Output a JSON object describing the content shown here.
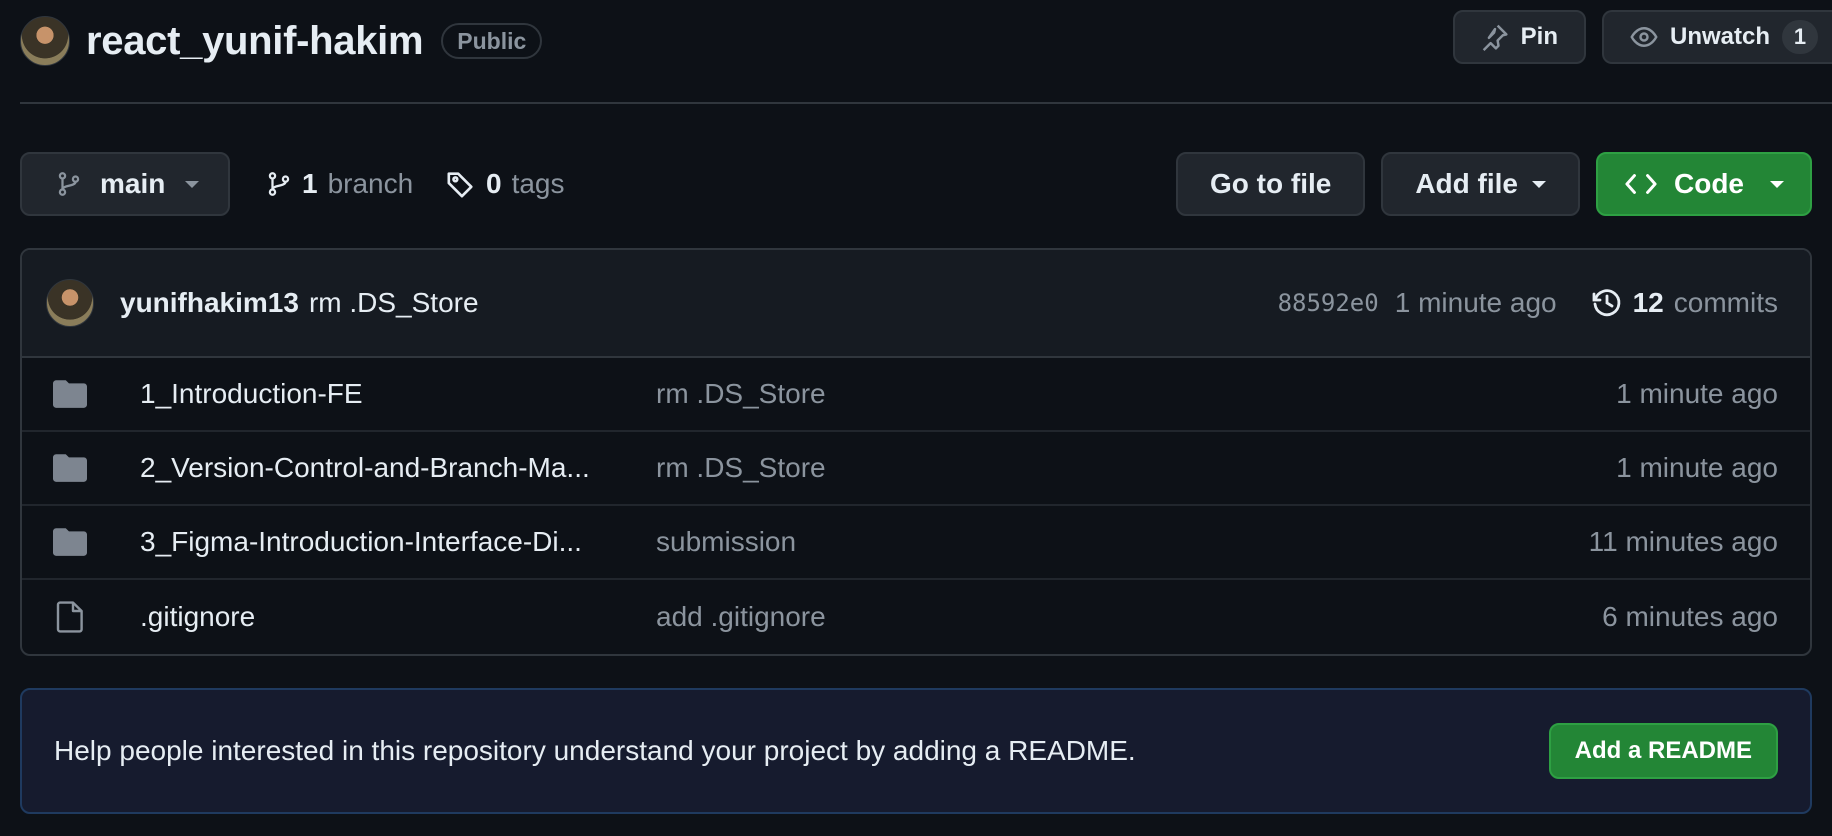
{
  "repo": {
    "name": "react_yunif-hakim",
    "visibility": "Public"
  },
  "header_actions": {
    "pin_label": "Pin",
    "unwatch_label": "Unwatch",
    "watch_count": "1"
  },
  "toolbar": {
    "branch_name": "main",
    "branch_count": "1",
    "branch_label": "branch",
    "tag_count": "0",
    "tag_label": "tags",
    "go_to_file_label": "Go to file",
    "add_file_label": "Add file",
    "code_label": "Code"
  },
  "latest_commit": {
    "author": "yunifhakim13",
    "message": "rm .DS_Store",
    "sha": "88592e0",
    "time": "1 minute ago",
    "commit_count": "12",
    "commits_label": "commits"
  },
  "files": [
    {
      "type": "folder",
      "name": "1_Introduction-FE",
      "commit": "rm .DS_Store",
      "age": "1 minute ago"
    },
    {
      "type": "folder",
      "name": "2_Version-Control-and-Branch-Ma...",
      "commit": "rm .DS_Store",
      "age": "1 minute ago"
    },
    {
      "type": "folder",
      "name": "3_Figma-Introduction-Interface-Di...",
      "commit": "submission",
      "age": "11 minutes ago"
    },
    {
      "type": "file",
      "name": ".gitignore",
      "commit": "add .gitignore",
      "age": "6 minutes ago"
    }
  ],
  "readme_banner": {
    "text": "Help people interested in this repository understand your project by adding a README.",
    "button_label": "Add a README"
  },
  "colors": {
    "background": "#0d1117",
    "primary_green": "#238636",
    "border": "#30363d",
    "muted_text": "#8b949e"
  },
  "icons": [
    "avatar",
    "pin-icon",
    "eye-icon",
    "branch-icon",
    "tag-icon",
    "code-icon",
    "history-icon",
    "folder-icon",
    "file-icon"
  ]
}
